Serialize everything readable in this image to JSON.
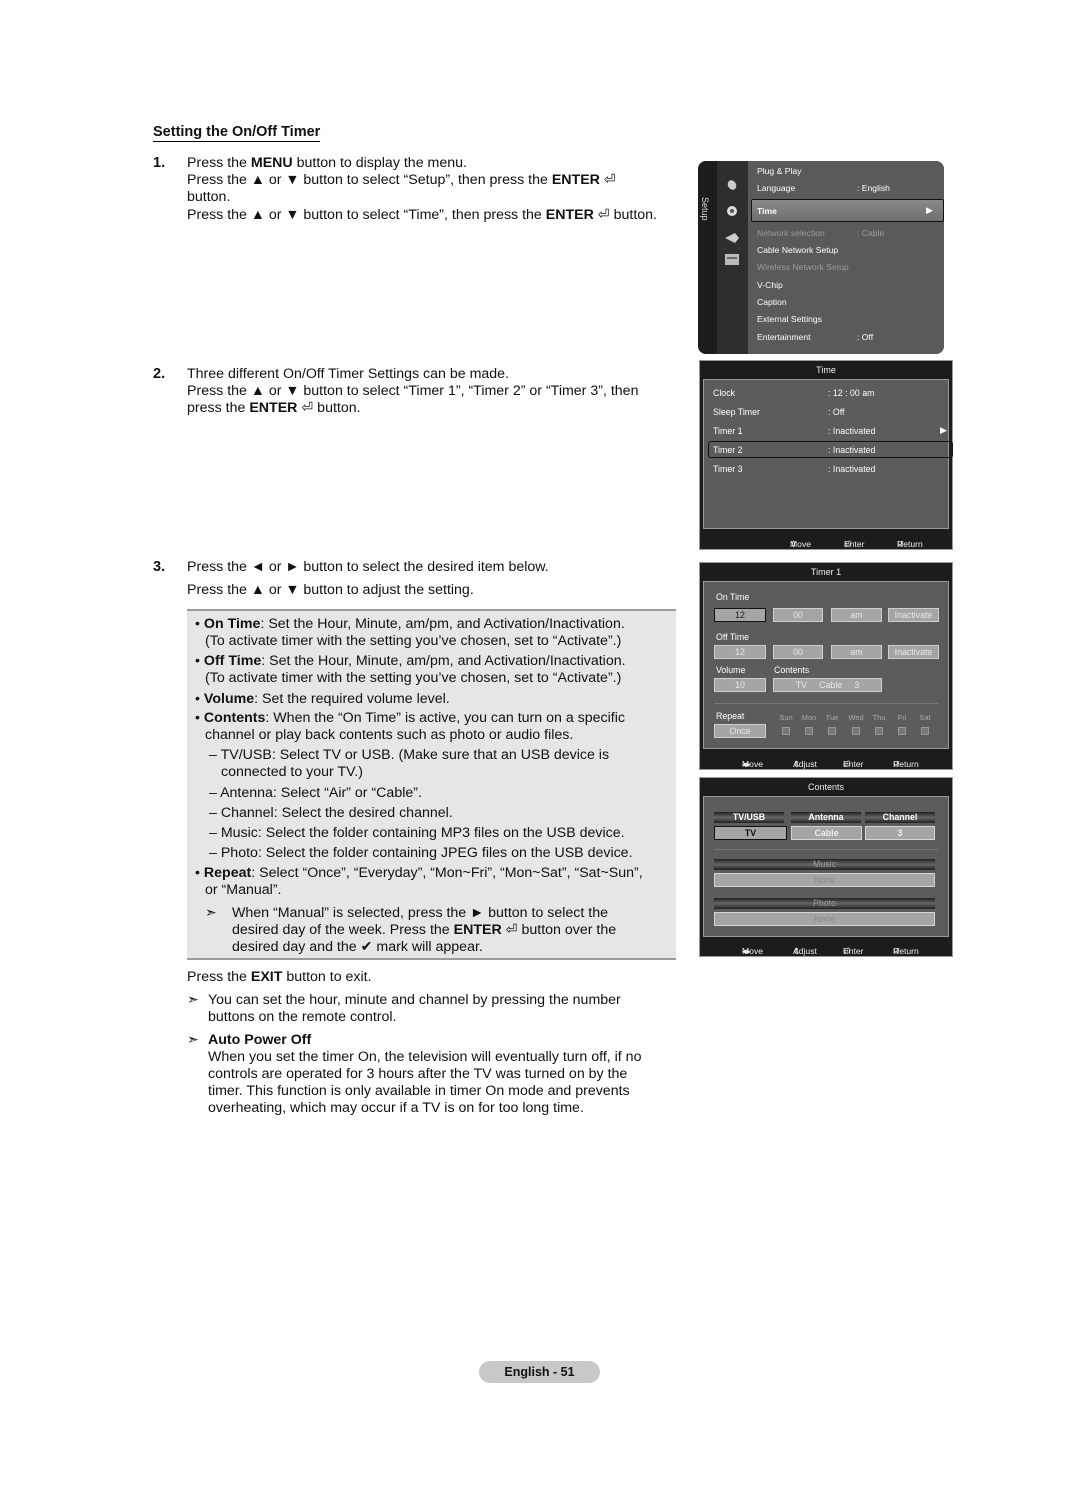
{
  "section_title": "Setting the On/Off Timer",
  "steps": [
    {
      "number": "1.",
      "lines": [
        {
          "pre": "Press the ",
          "bold": "MENU",
          "post": " button to display the menu."
        },
        {
          "pre": "Press the ▲ or ▼ button to select “Setup”, then press the ",
          "bold": "ENTER",
          "post": " ⏎"
        },
        {
          "pre": "button.",
          "bold": "",
          "post": ""
        },
        {
          "pre": "Press the ▲ or ▼ button to select “Time”, then press the ",
          "bold": "ENTER",
          "post": " ⏎ button."
        }
      ]
    },
    {
      "number": "2.",
      "lines": [
        {
          "pre": "Three different On/Off Timer Settings can be made.",
          "bold": "",
          "post": ""
        },
        {
          "pre": "Press the ▲ or ▼ button to select “Timer 1”, “Timer 2” or “Timer 3”, then",
          "bold": "",
          "post": ""
        },
        {
          "pre": "press the ",
          "bold": "ENTER",
          "post": " ⏎ button."
        }
      ]
    },
    {
      "number": "3.",
      "lines": [
        {
          "pre": "Press the ◄ or ► button to select the desired item below.",
          "bold": "",
          "post": ""
        },
        {
          "pre": "Press the ▲ or ▼ button to adjust the setting.",
          "bold": "",
          "post": ""
        }
      ]
    }
  ],
  "note_box": {
    "on_time": {
      "term": "On Time",
      "text": ": Set the Hour, Minute, am/pm, and Activation/Inactivation.",
      "cont": "(To activate timer with the setting you’ve chosen, set to “Activate”.)"
    },
    "off_time": {
      "term": "Off Time",
      "text": ": Set the Hour, Minute, am/pm, and Activation/Inactivation.",
      "cont": "(To activate timer with the setting you’ve chosen, set to “Activate”.)"
    },
    "volume": {
      "term": "Volume",
      "text": ": Set the required volume level."
    },
    "contents": {
      "term": "Contents",
      "text": ": When the “On Time” is active, you can turn on a specific",
      "cont": "channel or play back contents such as photo or audio files."
    },
    "sub_items": [
      {
        "line1": "TV/USB: Select TV or USB. (Make sure that an USB device is",
        "line2": "connected to your TV.)"
      },
      {
        "line1": "Antenna: Select “Air” or “Cable”.",
        "line2": ""
      },
      {
        "line1": "Channel: Select the desired channel.",
        "line2": ""
      },
      {
        "line1": "Music: Select the folder containing MP3 files on the USB device.",
        "line2": ""
      },
      {
        "line1": "Photo: Select the folder containing JPEG files on the USB device.",
        "line2": ""
      }
    ],
    "repeat": {
      "term": "Repeat",
      "text": ": Select “Once”, “Everyday”, “Mon~Fri”, “Mon~Sat”, “Sat~Sun”,",
      "cont": "or “Manual”."
    },
    "manual_note": {
      "l1": "When “Manual” is selected, press the ► button to select the",
      "l2_pre": "desired day of the week. Press the ",
      "l2_bold": "ENTER",
      "l2_post": " ⏎ button over the",
      "l3": "desired day and the ✔ mark will appear."
    }
  },
  "exit_line": {
    "pre": "Press the ",
    "bold": "EXIT",
    "post": " button to exit."
  },
  "note_number_buttons": {
    "l1": "You can set the hour, minute and channel by pressing the number",
    "l2": "buttons on the remote control."
  },
  "auto_power_off": {
    "title": "Auto Power Off",
    "lines": [
      "When you set the timer On, the television will eventually turn off, if no",
      "controls are operated for 3 hours after the TV was turned on by the",
      "timer. This function is only available in timer On mode and prevents",
      "overheating, which may occur if a TV is on for too long time."
    ]
  },
  "arrow_glyph": "➣",
  "page_label": "English - 51",
  "setup_menu": {
    "side_label": "Setup",
    "items": [
      {
        "label": "Plug & Play",
        "value": "",
        "dim": false
      },
      {
        "label": "Language",
        "value": ": English",
        "dim": false
      },
      {
        "label": "Time",
        "value": "",
        "dim": false,
        "selected": true
      },
      {
        "label": "Network selection",
        "value": ": Cable",
        "dim": true
      },
      {
        "label": "Cable Network Setup",
        "value": "",
        "dim": false
      },
      {
        "label": "Wireless Network Setup",
        "value": "",
        "dim": true
      },
      {
        "label": "V-Chip",
        "value": "",
        "dim": false
      },
      {
        "label": "Caption",
        "value": "",
        "dim": false
      },
      {
        "label": "External Settings",
        "value": "",
        "dim": false
      },
      {
        "label": "Entertainment",
        "value": ": Off",
        "dim": false
      }
    ],
    "icons": [
      "satellite-dish-icon",
      "gear-icon",
      "input-icon",
      "application-icon"
    ]
  },
  "time_menu": {
    "title": "Time",
    "rows": [
      {
        "label": "Clock",
        "value": ": 12 : 00  am"
      },
      {
        "label": "Sleep Timer",
        "value": ": Off"
      },
      {
        "label": "Timer 1",
        "value": ": Inactivated",
        "selected": true
      },
      {
        "label": "Timer 2",
        "value": ": Inactivated"
      },
      {
        "label": "Timer 3",
        "value": ": Inactivated"
      }
    ],
    "footer": {
      "move": "Move",
      "enter": "Enter",
      "return": "Return"
    }
  },
  "timer1_menu": {
    "title": "Timer 1",
    "on_time_label": "On Time",
    "on_time": {
      "hour": "12",
      "minute": "00",
      "ampm": "am",
      "activation": "Inactivate"
    },
    "off_time_label": "Off Time",
    "off_time": {
      "hour": "12",
      "minute": "00",
      "ampm": "am",
      "activation": "Inactivate"
    },
    "volume_label": "Volume",
    "volume": "10",
    "contents_label": "Contents",
    "contents_value": "TV     Cable     3",
    "repeat_label": "Repeat",
    "repeat_value": "Once",
    "days": [
      "Sun",
      "Mon",
      "Tue",
      "Wed",
      "Thu",
      "Fri",
      "Sat"
    ],
    "footer": {
      "move": "Move",
      "adjust": "Adjust",
      "enter": "Enter",
      "return": "Return"
    }
  },
  "contents_menu": {
    "title": "Contents",
    "columns": [
      {
        "header": "TV/USB",
        "value": "TV"
      },
      {
        "header": "Antenna",
        "value": "Cable"
      },
      {
        "header": "Channel",
        "value": "3"
      }
    ],
    "music_label": "Music",
    "music_value": "None",
    "photo_label": "Photo",
    "photo_value": "None",
    "footer": {
      "move": "Move",
      "adjust": "Adjust",
      "enter": "Enter",
      "return": "Return"
    }
  }
}
